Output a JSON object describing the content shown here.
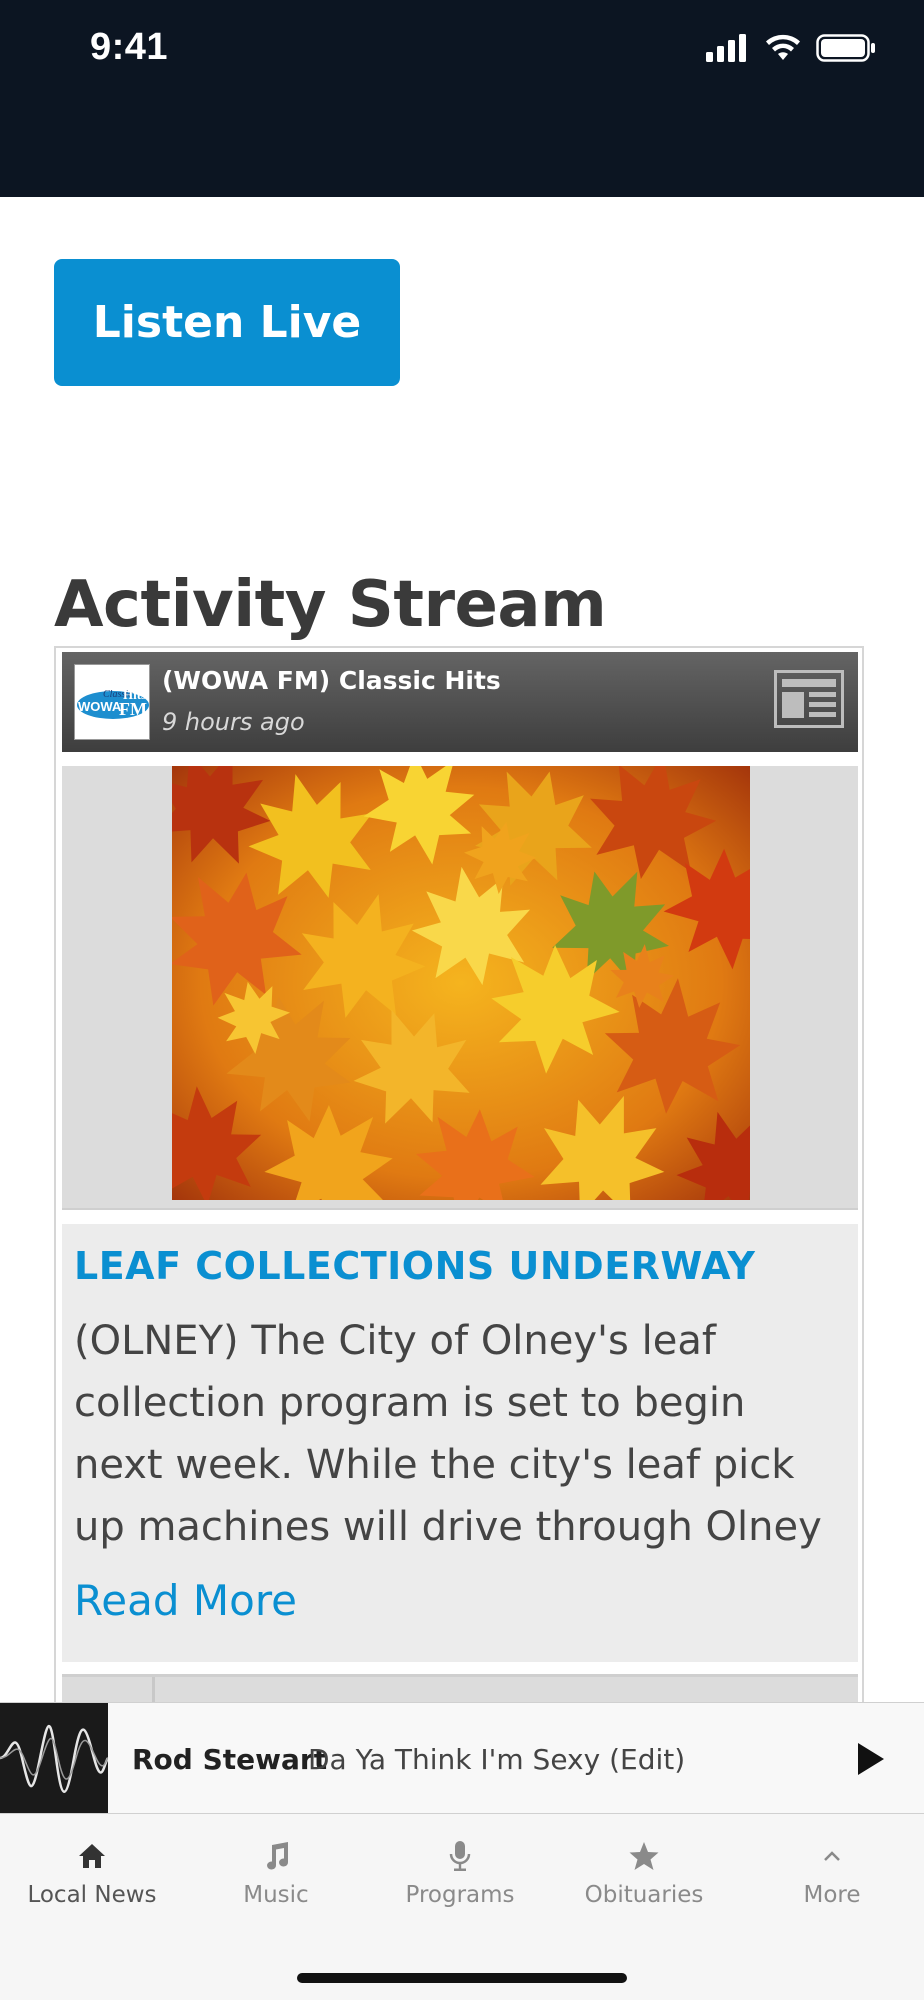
{
  "status_bar": {
    "time": "9:41",
    "icons": [
      "signal-icon",
      "wifi-icon",
      "battery-icon"
    ],
    "background": "#0c1522"
  },
  "listen_live": {
    "label": "Listen Live",
    "color": "#0a8fd1"
  },
  "activity_stream": {
    "title": "Activity Stream",
    "card": {
      "station_name": "(WOWA FM) Classic Hits",
      "time_ago": "9 hours ago",
      "logo_text": "Classic Hits WOWA 93.7FM",
      "headline": "LEAF COLLECTIONS UNDERWAY",
      "excerpt": "(OLNEY) The City of Olney's leaf collection program is set to begin next week. While the city's leaf pick up machines will drive through Olney",
      "read_more": "Read More",
      "accent": "#0a8fd1"
    }
  },
  "now_playing": {
    "artist": "Rod Stewart",
    "song": "Da Ya Think I'm Sexy (Edit)"
  },
  "tabs": [
    {
      "label": "Local News",
      "icon": "home-icon"
    },
    {
      "label": "Music",
      "icon": "music-note-icon"
    },
    {
      "label": "Programs",
      "icon": "microphone-icon"
    },
    {
      "label": "Obituaries",
      "icon": "star-icon"
    },
    {
      "label": "More",
      "icon": "chevron-up-icon"
    }
  ]
}
